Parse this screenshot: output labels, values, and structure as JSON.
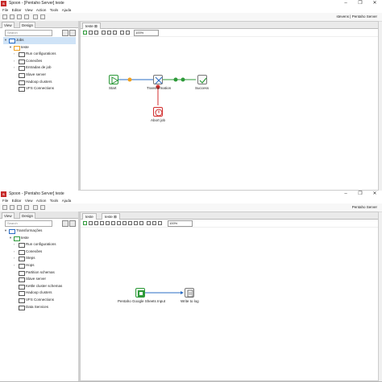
{
  "top": {
    "title": "Spoon - [Pentaho Server] teste",
    "menu": [
      "File",
      "Editar",
      "View",
      "Action",
      "Tools",
      "Ajuda"
    ],
    "perspective": "stevens  |  Pentaho Server",
    "left_tabs": {
      "view": "View",
      "design": "Design"
    },
    "search_placeholder": "Search",
    "tree": [
      {
        "label": "Jobs",
        "level": 0,
        "selected": true
      },
      {
        "label": "teste",
        "level": 1
      },
      {
        "label": "Run configurations",
        "level": 2
      },
      {
        "label": "Conexões",
        "level": 2
      },
      {
        "label": "Entradas de job",
        "level": 2
      },
      {
        "label": "Slave server",
        "level": 2
      },
      {
        "label": "Hadoop clusters",
        "level": 2
      },
      {
        "label": "VFS Connections",
        "level": 2
      }
    ],
    "doc_tab": "teste",
    "zoom": "100%",
    "steps": {
      "start": "Start",
      "transformation": "Transformation",
      "success": "Success",
      "abort": "Abort job"
    }
  },
  "bottom": {
    "title": "Spoon - [Pentaho Server] teste",
    "menu": [
      "File",
      "Editar",
      "View",
      "Action",
      "Tools",
      "Ajuda"
    ],
    "perspective": "Pentaho Server",
    "left_tabs": {
      "view": "View",
      "design": "Design"
    },
    "search_placeholder": "Search",
    "tree": [
      {
        "label": "Transformações",
        "level": 0
      },
      {
        "label": "teste",
        "level": 1
      },
      {
        "label": "Run configurations",
        "level": 2
      },
      {
        "label": "Conexões",
        "level": 2
      },
      {
        "label": "Steps",
        "level": 2
      },
      {
        "label": "Hops",
        "level": 2
      },
      {
        "label": "Partition schemas",
        "level": 2
      },
      {
        "label": "Slave server",
        "level": 2
      },
      {
        "label": "Kettle cluster schemas",
        "level": 2
      },
      {
        "label": "Hadoop clusters",
        "level": 2
      },
      {
        "label": "VFS Connections",
        "level": 2
      },
      {
        "label": "Data Services",
        "level": 2
      }
    ],
    "doc_tabs": [
      "teste",
      "teste"
    ],
    "zoom": "100%",
    "steps": {
      "input": "Pentaho Google Sheets Input",
      "output": "Write to log"
    }
  },
  "colors": {
    "green": "#2e9a3a",
    "orange": "#f0a020",
    "red": "#d32f2f",
    "blue": "#2a6cc4",
    "selection": "#cfe3f7"
  }
}
